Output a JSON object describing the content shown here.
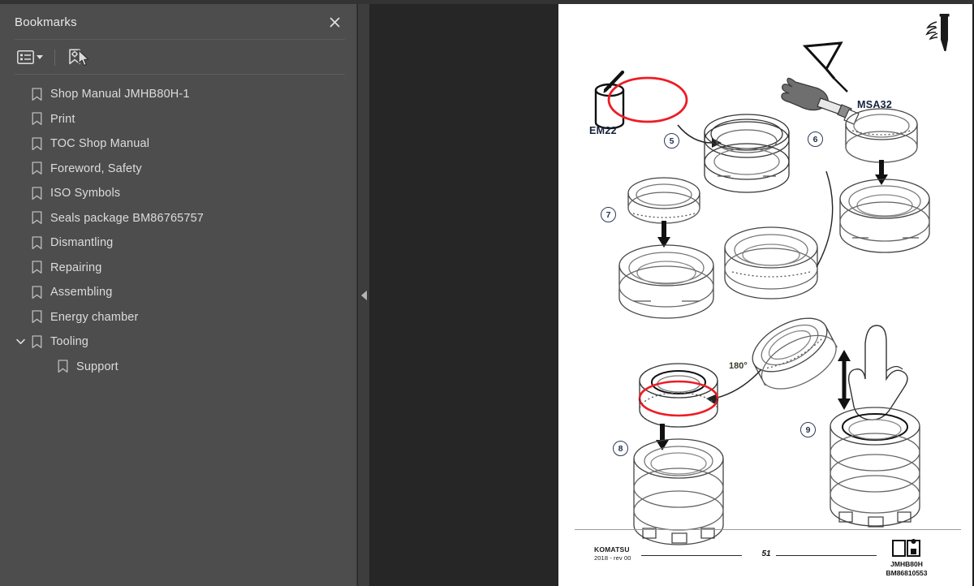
{
  "sidebar": {
    "title": "Bookmarks",
    "close_label": "×",
    "toolbar": {
      "options_icon": "list-options-icon",
      "dropdown_caret": "chevron-down-icon",
      "bookmark_settings_icon": "bookmark-settings-icon"
    },
    "items": [
      {
        "label": "Shop Manual JMHB80H-1",
        "level": 0,
        "expandable": false,
        "expanded": false
      },
      {
        "label": "Print",
        "level": 0,
        "expandable": false,
        "expanded": false
      },
      {
        "label": "TOC Shop Manual",
        "level": 0,
        "expandable": false,
        "expanded": false
      },
      {
        "label": "Foreword, Safety",
        "level": 0,
        "expandable": false,
        "expanded": false
      },
      {
        "label": "ISO Symbols",
        "level": 0,
        "expandable": false,
        "expanded": false
      },
      {
        "label": "Seals package BM86765757",
        "level": 0,
        "expandable": false,
        "expanded": false
      },
      {
        "label": "Dismantling",
        "level": 0,
        "expandable": false,
        "expanded": false
      },
      {
        "label": "Repairing",
        "level": 0,
        "expandable": false,
        "expanded": false
      },
      {
        "label": "Assembling",
        "level": 0,
        "expandable": false,
        "expanded": false
      },
      {
        "label": "Energy chamber",
        "level": 0,
        "expandable": false,
        "expanded": false
      },
      {
        "label": "Tooling",
        "level": 0,
        "expandable": true,
        "expanded": true
      },
      {
        "label": "Support",
        "level": 1,
        "expandable": false,
        "expanded": false
      }
    ]
  },
  "collapse_handle": {
    "icon": "triangle-left-icon"
  },
  "document": {
    "steps": [
      {
        "number": "5"
      },
      {
        "number": "6"
      },
      {
        "number": "7"
      },
      {
        "number": "8"
      },
      {
        "number": "9"
      }
    ],
    "tool_labels": [
      {
        "text": "EM22"
      },
      {
        "text": "MSA32"
      }
    ],
    "annotations": [
      {
        "text": "180°"
      }
    ],
    "colors": {
      "seal_red": "#ed1c24",
      "line_dark": "#1a1a1a",
      "line_gray": "#6e6e6e",
      "glove_gray": "#6f6f6f"
    },
    "footer": {
      "brand": "KOMATSU",
      "revision": "2018 -  rev 00",
      "page_number": "51",
      "model": "JMHB80H",
      "part_number": "BM86810553",
      "manual_icon": "open-manual-icon"
    },
    "header_icon": "chisel-hammer-icon"
  }
}
